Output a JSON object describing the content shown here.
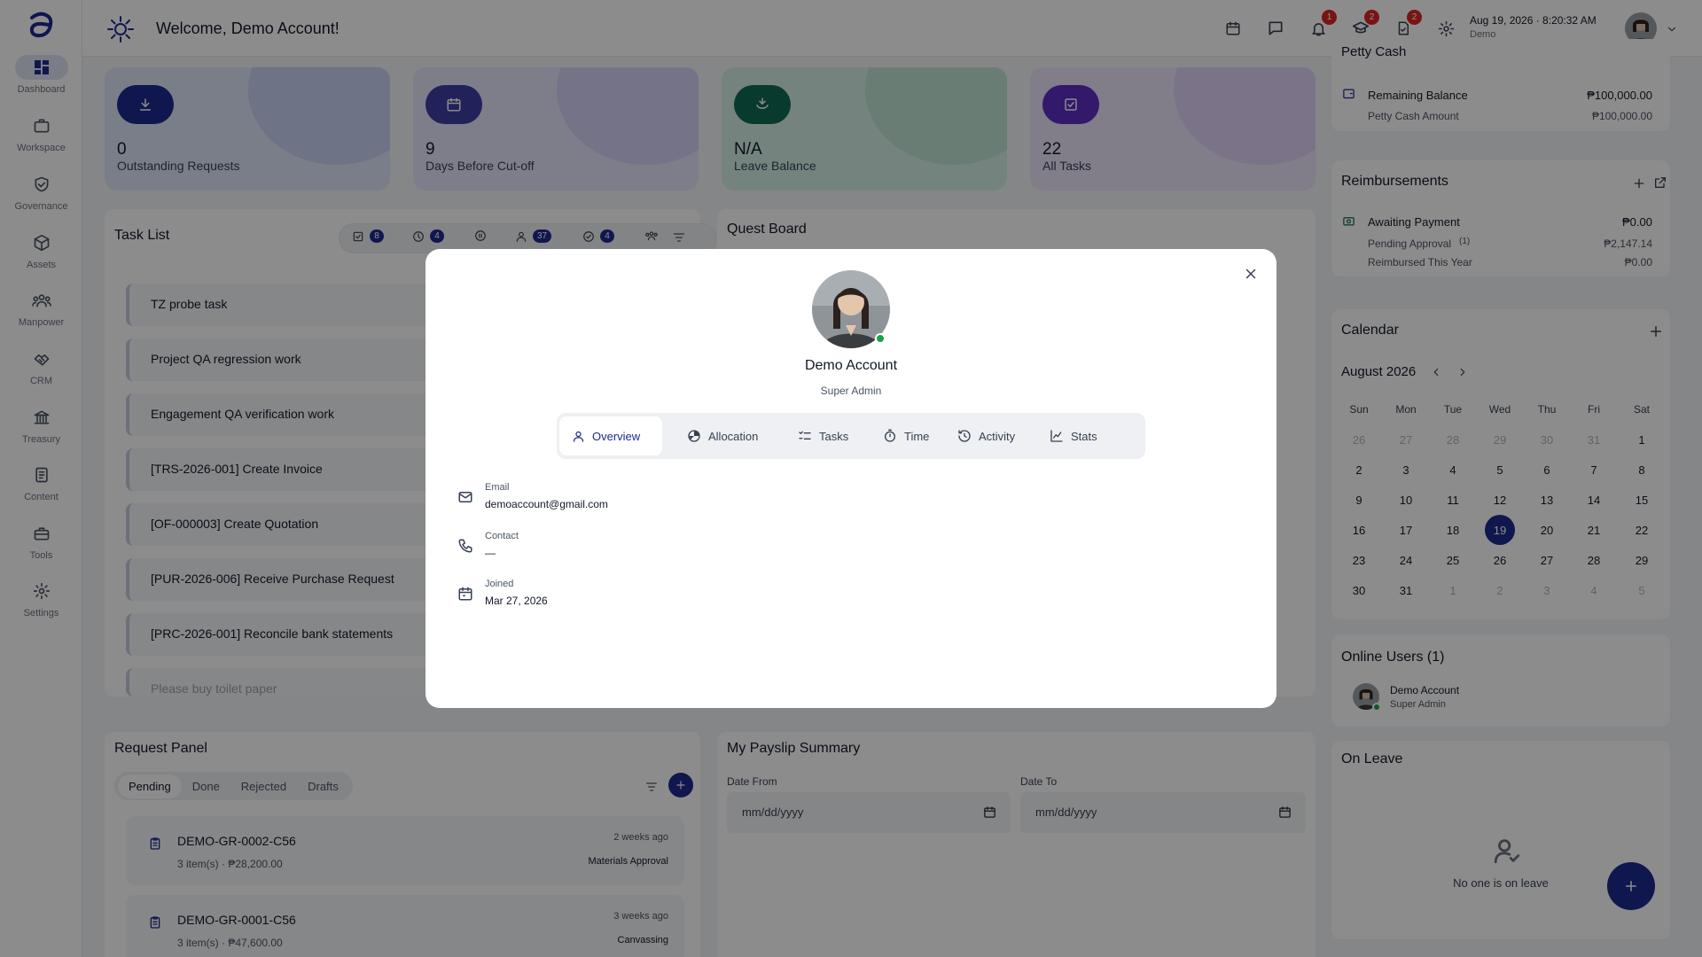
{
  "sidebar": {
    "items": [
      {
        "label": "Dashboard",
        "icon": "dashboard-icon"
      },
      {
        "label": "Workspace",
        "icon": "briefcase-icon"
      },
      {
        "label": "Governance",
        "icon": "shield-check-icon"
      },
      {
        "label": "Assets",
        "icon": "cube-icon"
      },
      {
        "label": "Manpower",
        "icon": "users-icon"
      },
      {
        "label": "CRM",
        "icon": "handshake-icon"
      },
      {
        "label": "Treasury",
        "icon": "bank-icon"
      },
      {
        "label": "Content",
        "icon": "document-icon"
      },
      {
        "label": "Tools",
        "icon": "toolbox-icon"
      },
      {
        "label": "Settings",
        "icon": "gear-icon"
      }
    ]
  },
  "header": {
    "welcome": "Welcome, Demo Account!",
    "notifications_badge": "1",
    "courses_badge": "2",
    "documents_badge": "2",
    "datetime": "Aug 19, 2026 · 8:20:32 AM",
    "user_label": "Demo"
  },
  "stats": [
    {
      "value": "0",
      "label": "Outstanding Requests",
      "color": "#1e2b8f"
    },
    {
      "value": "9",
      "label": "Days Before Cut-off",
      "color": "#3b3fa3"
    },
    {
      "value": "N/A",
      "label": "Leave Balance",
      "color": "#0f6b52"
    },
    {
      "value": "22",
      "label": "All Tasks",
      "color": "#5b2ec4"
    }
  ],
  "tasks": {
    "title": "Task List",
    "chips": [
      "8",
      "4",
      "37",
      "4"
    ],
    "items": [
      "TZ probe task",
      "Project QA regression work",
      "Engagement QA verification work",
      "[TRS-2026-001] Create Invoice",
      "[OF-000003] Create Quotation",
      "[PUR-2026-006] Receive Purchase Request",
      "[PRC-2026-001] Reconcile bank statements",
      "Please buy toilet paper"
    ]
  },
  "quest": {
    "title": "Quest Board"
  },
  "requests": {
    "title": "Request Panel",
    "tabs": [
      "Pending",
      "Done",
      "Rejected",
      "Drafts"
    ],
    "items": [
      {
        "id": "DEMO-GR-0002-C56",
        "sub": "3 item(s) · ₱28,200.00",
        "time": "2 weeks ago",
        "tag": "Materials Approval"
      },
      {
        "id": "DEMO-GR-0001-C56",
        "sub": "3 item(s) · ₱47,600.00",
        "time": "3 weeks ago",
        "tag": "Canvassing"
      }
    ]
  },
  "payslip": {
    "title": "My Payslip Summary",
    "from_label": "Date From",
    "to_label": "Date To",
    "from_placeholder": "mm/dd/yyyy",
    "to_placeholder": "mm/dd/yyyy"
  },
  "petty": {
    "title": "Petty Cash",
    "balance_label": "Remaining Balance",
    "balance_value": "₱100,000.00",
    "amount_label": "Petty Cash Amount",
    "amount_value": "₱100,000.00"
  },
  "reimburse": {
    "title": "Reimbursements",
    "awaiting_label": "Awaiting Payment",
    "awaiting_value": "₱0.00",
    "pending_label": "Pending Approval",
    "pending_count": "(1)",
    "pending_value": "₱2,147.14",
    "reimbursed_label": "Reimbursed This Year",
    "reimbursed_value": "₱0.00"
  },
  "calendar": {
    "title": "Calendar",
    "month": "August 2026",
    "days": [
      "Sun",
      "Mon",
      "Tue",
      "Wed",
      "Thu",
      "Fri",
      "Sat"
    ],
    "cells": [
      "26",
      "27",
      "28",
      "29",
      "30",
      "31",
      "1",
      "2",
      "3",
      "4",
      "5",
      "6",
      "7",
      "8",
      "9",
      "10",
      "11",
      "12",
      "13",
      "14",
      "15",
      "16",
      "17",
      "18",
      "19",
      "20",
      "21",
      "22",
      "23",
      "24",
      "25",
      "26",
      "27",
      "28",
      "29",
      "30",
      "31",
      "1",
      "2",
      "3",
      "4",
      "5"
    ],
    "today": "19"
  },
  "online": {
    "title": "Online Users (1)",
    "name": "Demo Account",
    "role": "Super Admin"
  },
  "leave": {
    "title": "On Leave",
    "empty": "No one is on leave"
  },
  "modal": {
    "name": "Demo Account",
    "role": "Super Admin",
    "tabs": [
      "Overview",
      "Allocation",
      "Tasks",
      "Time",
      "Activity",
      "Stats"
    ],
    "email_label": "Email",
    "email_value": "demoaccount@gmail.com",
    "contact_label": "Contact",
    "contact_value": "—",
    "joined_label": "Joined",
    "joined_value": "Mar 27, 2026"
  }
}
